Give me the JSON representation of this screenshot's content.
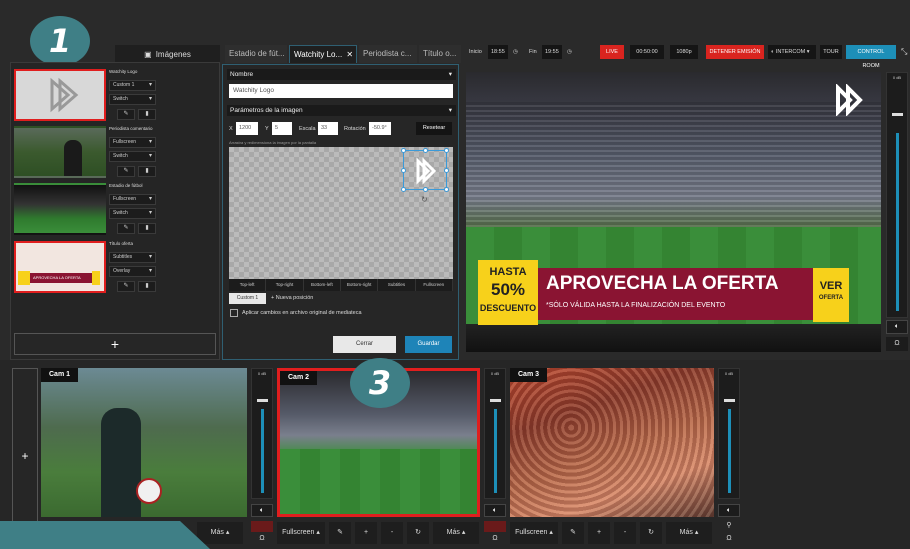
{
  "badges": {
    "one": "1",
    "three": "3"
  },
  "left_panel": {
    "tab_label": "Imágenes",
    "add_label": "+",
    "items": [
      {
        "name": "Watchity Logo",
        "mode": "Custom 1",
        "action": "Switch"
      },
      {
        "name": "Periodista comentario",
        "mode": "Fullscreen",
        "action": "Switch"
      },
      {
        "name": "Estadio de fútbol",
        "mode": "Fullscreen",
        "action": "Switch"
      },
      {
        "name": "Título oferta",
        "mode": "Subtitles",
        "action": "Overlay"
      }
    ]
  },
  "editor": {
    "tabs": [
      "Estadio de fút...",
      "Watchity Lo...",
      "Periodista c...",
      "Título o..."
    ],
    "section_name": "Nombre",
    "name_value": "Watchity Logo",
    "section_params": "Parámetros de la imagen",
    "x_label": "X",
    "x_value": "1200",
    "y_label": "Y",
    "y_value": "5",
    "scale_label": "Escala",
    "scale_value": "33",
    "rotation_label": "Rotación",
    "rotation_value": "-50.9°",
    "reset_label": "Resetear",
    "hint": "Arrastra y redimensiona la imagen por la pantalla",
    "positions": [
      "Top-left",
      "Top-right",
      "Bottom-left",
      "Bottom-right",
      "Subtitles",
      "Fullscreen"
    ],
    "custom_label": "Custom 1",
    "new_position": "+ Nueva posición",
    "apply_label": "Aplicar cambios en archivo original de mediateca",
    "cancel_label": "Cerrar",
    "save_label": "Guardar"
  },
  "statusbar": {
    "start_label": "Inicio",
    "start_value": "18:55",
    "end_label": "Fin",
    "end_value": "19:55",
    "live": "LIVE",
    "timer": "00:50:00",
    "resolution": "1080p",
    "stop": "DETENER EMISIÓN",
    "intercom": "INTERCOM",
    "tour": "TOUR",
    "control_room": "CONTROL ROOM"
  },
  "preview": {
    "promo_hasta": "HASTA",
    "promo_pct": "50%",
    "promo_desc": "DESCUENTO",
    "promo_title": "APROVECHA LA OFERTA",
    "promo_sub": "*SÓLO VÁLIDA HASTA LA FINALIZACIÓN DEL EVENTO",
    "promo_ver": "VER",
    "promo_oferta": "OFERTA",
    "thumb_title": "APROVECHA LA OFERTA"
  },
  "meters": {
    "db": "0 dB"
  },
  "cams": [
    {
      "label": "Cam 1",
      "more": "Más"
    },
    {
      "label": "Cam 2",
      "mode": "Fullscreen",
      "plus": "+",
      "minus": "-",
      "more": "Más"
    },
    {
      "label": "Cam 3",
      "mode": "Fullscreen",
      "plus": "+",
      "minus": "-",
      "more": "Más"
    }
  ],
  "side_add": "+"
}
